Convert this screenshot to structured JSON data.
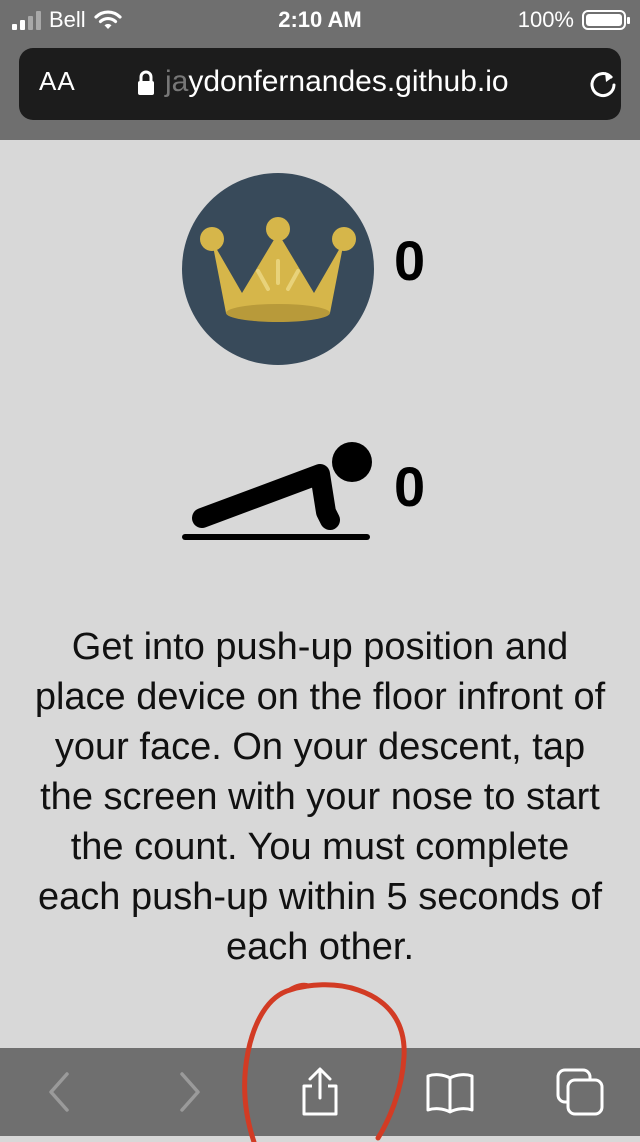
{
  "status_bar": {
    "carrier": "Bell",
    "time": "2:10 AM",
    "battery": "100%"
  },
  "url_bar": {
    "text_size_label": "AA",
    "domain_faded": "ja",
    "domain_text": "ydonfernandes.github.io"
  },
  "page": {
    "high_score": "0",
    "pushup_count": "0",
    "instructions": "Get into push-up position and place device on the floor infront of your face. On your descent, tap the screen with your nose to start the count. You must complete each push-up within 5 seconds of each other."
  },
  "colors": {
    "page_background": "#d8d8d8",
    "browser_chrome": "#6f6f6f",
    "crown_circle": "#384a5a",
    "crown_gold": "#d6b64a",
    "annotation_red": "#d23b24"
  },
  "icons": [
    "signal-icon",
    "wifi-icon",
    "battery-icon",
    "lock-icon",
    "reload-icon",
    "crown-icon",
    "pushup-icon",
    "back-icon",
    "forward-icon",
    "share-icon",
    "bookmarks-icon",
    "tabs-icon"
  ]
}
